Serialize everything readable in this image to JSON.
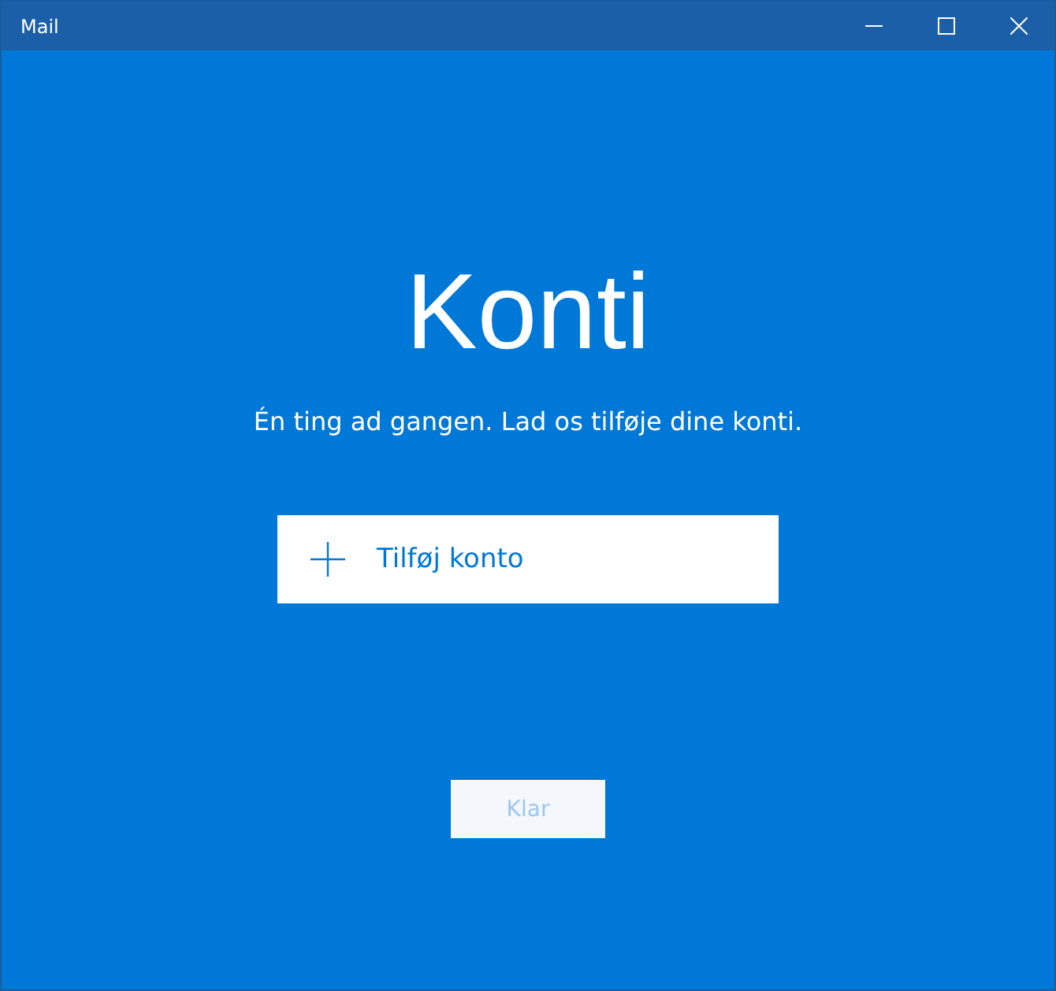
{
  "window": {
    "title": "Mail"
  },
  "heading": "Konti",
  "subtitle": "Én ting ad gangen. Lad os tilføje dine konti.",
  "add_button": {
    "label": "Tilføj konto"
  },
  "done_button": {
    "label": "Klar",
    "disabled": true
  }
}
